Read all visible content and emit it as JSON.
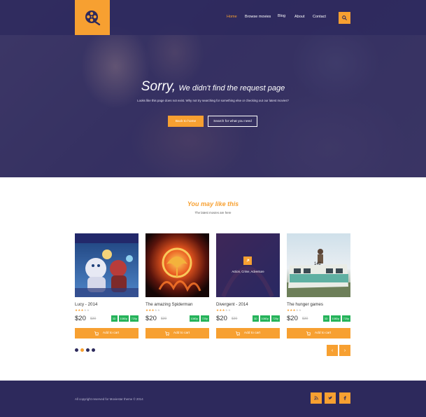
{
  "colors": {
    "accent": "#f7a031",
    "navy": "#2d295c",
    "green": "#25b35a"
  },
  "logo": {
    "icon": "film-reel-icon"
  },
  "nav": {
    "items": [
      {
        "label": "Home",
        "active": true
      },
      {
        "label": "Browse movies",
        "active": false
      },
      {
        "label": "Blog",
        "active": false
      },
      {
        "label": "About",
        "active": false
      },
      {
        "label": "Contact",
        "active": false
      }
    ],
    "search_icon": "search-icon"
  },
  "hero": {
    "title_big": "Sorry,",
    "title_small": "We didn't find the request page",
    "subtitle": "Looks like this page does not exist. Why not try searching for something else or checking out our latest movies?",
    "btn_home": "Back to home",
    "btn_search": "Search for what you need"
  },
  "section": {
    "title": "You may like this",
    "subtitle": "The latest movies are here"
  },
  "cards": [
    {
      "title": "Lucy - 2014",
      "rating": 3,
      "price": "$20",
      "old_price": "$30",
      "badges": [
        "3D",
        "1080p",
        "720p"
      ],
      "cart": "Add to cart"
    },
    {
      "title": "The amazing Spiderman",
      "rating": 3,
      "price": "$20",
      "old_price": "$30",
      "badges": [
        "1080p",
        "720p"
      ],
      "cart": "Add to cart"
    },
    {
      "title": "Divergent - 2014",
      "rating": 3,
      "price": "$20",
      "old_price": "$30",
      "badges": [
        "3D",
        "1080p",
        "720p"
      ],
      "cart": "Add to cart",
      "overlay_genre": "Action, Crime, Adventure"
    },
    {
      "title": "The hunger games",
      "rating": 3,
      "price": "$20",
      "old_price": "$30",
      "badges": [
        "3D",
        "1080p",
        "720p"
      ],
      "cart": "Add to cart",
      "bus_number": "142"
    }
  ],
  "pager": {
    "dots": 4,
    "active_dot": 2,
    "prev": "‹",
    "next": "›"
  },
  "footer": {
    "copyright": "All copyright reserved for Moviestar theme © 2014",
    "social": [
      "rss-icon",
      "twitter-icon",
      "facebook-icon"
    ]
  }
}
